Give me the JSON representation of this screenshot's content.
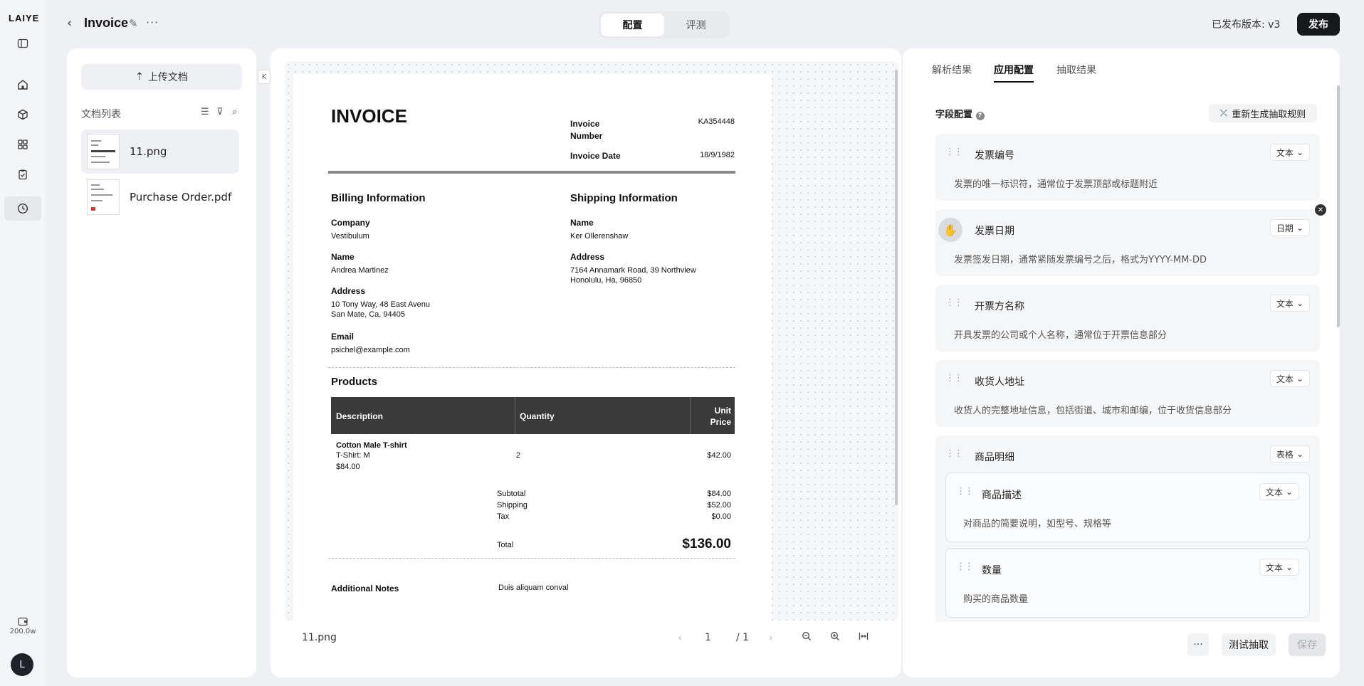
{
  "app": {
    "logo": "LAIYE",
    "credits": "200.0w",
    "avatar_initial": "L"
  },
  "header": {
    "title": "Invoice",
    "tabs": [
      "配置",
      "评测"
    ],
    "active_tab": 0,
    "version": "已发布版本: v3",
    "publish": "发布"
  },
  "sidebar": {
    "icons": [
      "panel-toggle-icon",
      "home-icon",
      "cube-icon",
      "grid-icon",
      "clipboard-icon",
      "clock-icon"
    ],
    "active": "clock-icon"
  },
  "docs": {
    "upload": "上传文档",
    "list_title": "文档列表",
    "items": [
      {
        "name": "11.png",
        "selected": true
      },
      {
        "name": "Purchase Order.pdf",
        "selected": false
      }
    ]
  },
  "invoice": {
    "title": "INVOICE",
    "number_label": "Invoice Number",
    "number_value": "KA354448",
    "date_label": "Invoice Date",
    "date_value": "18/9/1982",
    "billing_title": "Billing Information",
    "shipping_title": "Shipping Information",
    "billing": [
      {
        "label": "Company",
        "value": "Vestibulum"
      },
      {
        "label": "Name",
        "value": "Andrea Martinez"
      },
      {
        "label": "Address",
        "value": "10 Tony Way, 48 East Avenu",
        "value2": "San Mate, Ca, 94405"
      },
      {
        "label": "Email",
        "value": "psichel@example.com"
      }
    ],
    "shipping": [
      {
        "label": "Name",
        "value": "Ker Ollerenshaw"
      },
      {
        "label": "Address",
        "value": "7164 Annamark Road, 39 Northview",
        "value2": "Honolulu, Ha, 96850"
      }
    ],
    "products_title": "Products",
    "col_desc": "Description",
    "col_qty": "Quantity",
    "col_price": "Unit",
    "col_price2": "Price",
    "item": {
      "name": "Cotton Male T-shirt",
      "variant": "T-Shirt: M",
      "sub": "$84.00",
      "qty": "2",
      "price": "$42.00"
    },
    "subtotal_label": "Subtotal",
    "subtotal": "$84.00",
    "shipping_label": "Shipping",
    "shipping_cost": "$52.00",
    "tax_label": "Tax",
    "tax": "$0.00",
    "total_label": "Total",
    "total": "$136.00",
    "notes_label": "Additional Notes",
    "notes": "Duis aliquam conval"
  },
  "viewer": {
    "filename": "11.png",
    "page": "1",
    "pages": "/ 1"
  },
  "right": {
    "tabs": [
      "解析结果",
      "应用配置",
      "抽取结果"
    ],
    "active_tab": 1,
    "field_config": "字段配置",
    "regen": "重新生成抽取规则",
    "fields": [
      {
        "name": "发票编号",
        "type": "文本",
        "desc": "发票的唯一标识符，通常位于发票顶部或标题附近"
      },
      {
        "name": "发票日期",
        "type": "日期",
        "desc": "发票签发日期，通常紧随发票编号之后，格式为YYYY-MM-DD"
      },
      {
        "name": "开票方名称",
        "type": "文本",
        "desc": "开具发票的公司或个人名称，通常位于开票信息部分"
      },
      {
        "name": "收货人地址",
        "type": "文本",
        "desc": "收货人的完整地址信息，包括街道、城市和邮编，位于收货信息部分"
      },
      {
        "name": "商品明细",
        "type": "表格",
        "desc": ""
      }
    ],
    "subfields": [
      {
        "name": "商品描述",
        "type": "文本",
        "desc": "对商品的简要说明，如型号、规格等"
      },
      {
        "name": "数量",
        "type": "文本",
        "desc": "购买的商品数量"
      }
    ],
    "more": "···",
    "test": "测试抽取",
    "save": "保存"
  }
}
